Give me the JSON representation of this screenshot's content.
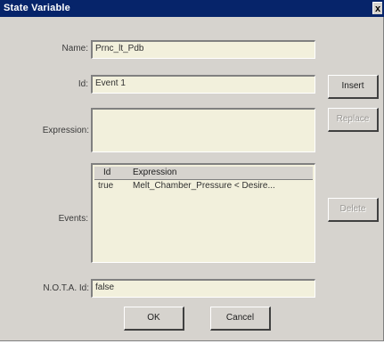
{
  "window": {
    "title": "State Variable",
    "close_glyph": "x"
  },
  "form": {
    "name_label": "Name:",
    "name_value": "Prnc_lt_Pdb",
    "id_label": "Id:",
    "id_value": "Event 1",
    "expression_label": "Expression:",
    "expression_value": "",
    "events_label": "Events:",
    "nota_label": "N.O.T.A. Id:",
    "nota_value": "false"
  },
  "events": {
    "columns": [
      "Id",
      "Expression"
    ],
    "rows": [
      {
        "id": "true",
        "expression": "Melt_Chamber_Pressure < Desire..."
      }
    ]
  },
  "side_buttons": {
    "insert": "Insert",
    "replace": "Replace",
    "delete": "Delete"
  },
  "footer": {
    "ok": "OK",
    "cancel": "Cancel"
  },
  "colors": {
    "title_bar": "#06246a",
    "dialog_bg": "#d6d3ce",
    "field_bg": "#f2f0dc"
  }
}
